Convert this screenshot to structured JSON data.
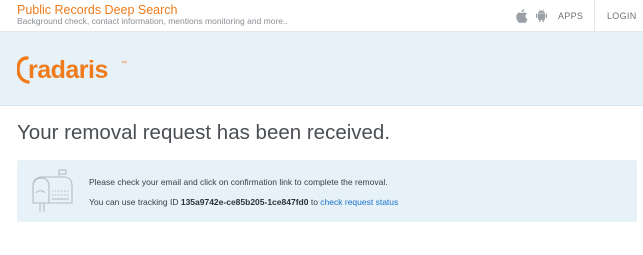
{
  "topbar": {
    "title": "Public Records Deep Search",
    "subtitle": "Background check, contact information, mentions monitoring and more..",
    "apps_label": "APPS",
    "login_label": "LOGIN"
  },
  "brand": {
    "logo_text": "radaris",
    "logo_mark": "™",
    "accent_color": "#f07b1a"
  },
  "main": {
    "heading": "Your removal request has been received.",
    "notice": {
      "line1": "Please check your email and click on confirmation link to complete the removal.",
      "line2_prefix": "You can use tracking ID",
      "tracking_id": "135a9742e-ce85b205-1ce847fd0",
      "line2_middle": "to",
      "status_link": "check request status"
    }
  },
  "icons": {
    "apple": "apple-icon",
    "android": "android-icon",
    "mailbox": "mailbox-icon"
  }
}
